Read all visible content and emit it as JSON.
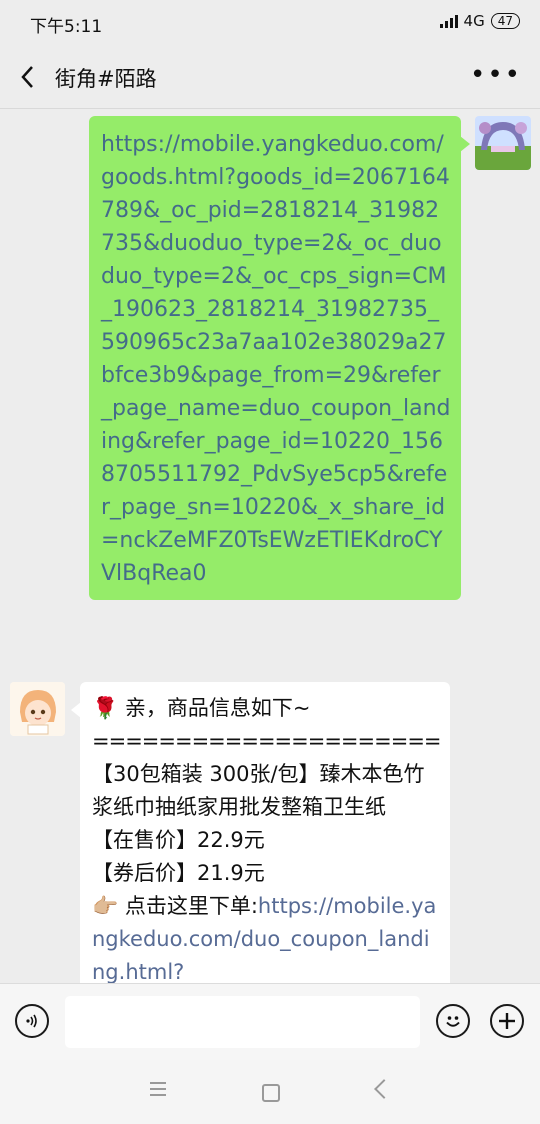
{
  "status_bar": {
    "time": "下午5:11",
    "network": "4G",
    "battery": "47"
  },
  "nav": {
    "title": "街角#陌路"
  },
  "messages": [
    {
      "side": "right",
      "text": "https://mobile.yangkeduo.com/goods.html?goods_id=2067164789&_oc_pid=2818214_31982735&duoduo_type=2&_oc_duoduo_type=2&_oc_cps_sign=CM_190623_2818214_31982735_590965c23a7aa102e38029a27bfce3b9&page_from=29&refer_page_name=duo_coupon_landing&refer_page_id=10220_1568705511792_PdvSye5cp5&refer_page_sn=10220&_x_share_id=nckZeMFZ0TsEWzETIEKdroCYVlBqRea0"
    },
    {
      "side": "left",
      "greeting_emoji": "🌹",
      "greeting": "亲，商品信息如下~",
      "divider": "=======================",
      "product": "【30包箱装 300张/包】臻木本色竹浆纸巾抽纸家用批发整箱卫生纸",
      "price_line": "【在售价】22.9元",
      "coupon_line": "【券后价】21.9元",
      "order_emoji": "👉🏼",
      "order_label": "点击这里下单:",
      "order_link": "https://mobile.yangkeduo.com/duo_coupon_landing.html?"
    }
  ],
  "colors": {
    "bubble_self": "#95ec69",
    "link": "#576b95",
    "background": "#ededed"
  },
  "icons": {
    "back": "chevron-left-icon",
    "more": "ellipsis-icon",
    "voice": "voice-icon",
    "emoji": "emoji-icon",
    "plus": "plus-icon"
  }
}
